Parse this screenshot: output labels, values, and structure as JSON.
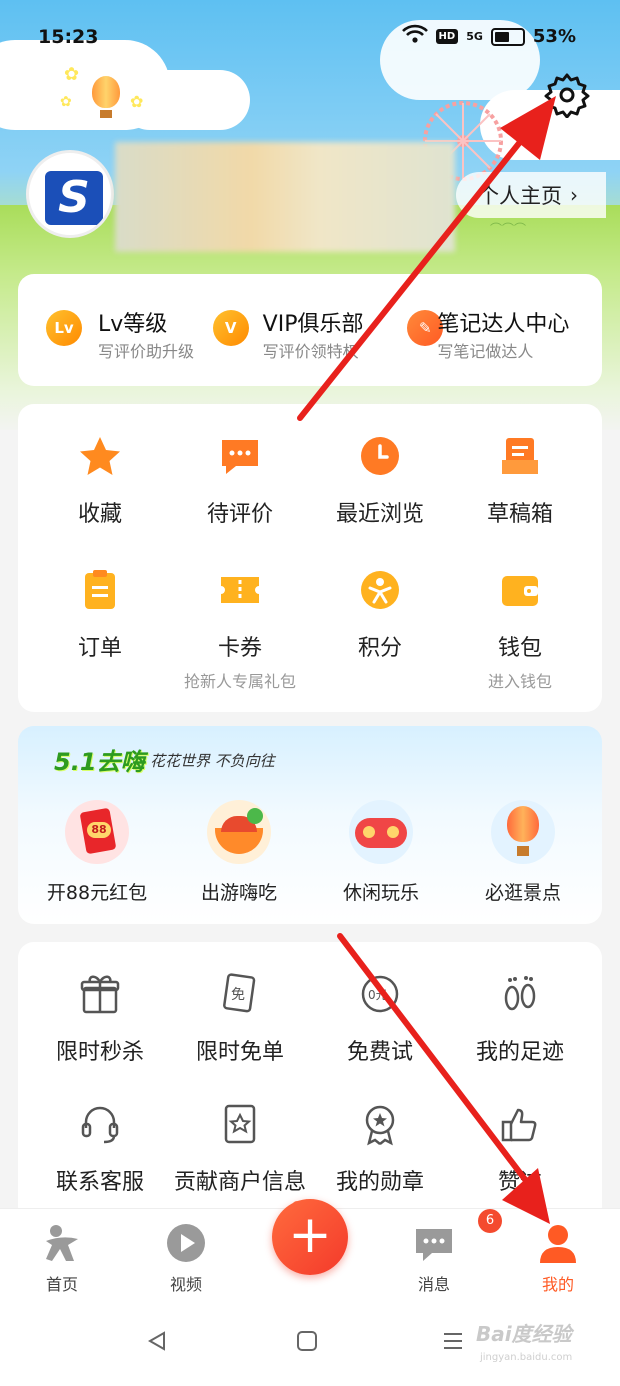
{
  "status": {
    "time": "15:23",
    "battery": "53%",
    "network": "5G",
    "hd": "HD",
    "battery_level": 0.53
  },
  "profile": {
    "link": "个人主页",
    "avatar_letter": "S"
  },
  "levels": [
    {
      "badge": "Lv",
      "title": "Lv等级",
      "sub": "写评价助升级"
    },
    {
      "badge": "V",
      "title": "VIP俱乐部",
      "sub": "写评价领特权"
    },
    {
      "badge": "✎",
      "title": "笔记达人中心",
      "sub": "写笔记做达人"
    }
  ],
  "grid1": [
    {
      "label": "收藏",
      "sub": ""
    },
    {
      "label": "待评价",
      "sub": ""
    },
    {
      "label": "最近浏览",
      "sub": ""
    },
    {
      "label": "草稿箱",
      "sub": ""
    },
    {
      "label": "订单",
      "sub": ""
    },
    {
      "label": "卡券",
      "sub": "抢新人专属礼包"
    },
    {
      "label": "积分",
      "sub": ""
    },
    {
      "label": "钱包",
      "sub": "进入钱包"
    }
  ],
  "promo": {
    "title": "5.1去嗨",
    "subtitle": "花花世界 不负向往",
    "items": [
      {
        "label": "开88元红包"
      },
      {
        "label": "出游嗨吃"
      },
      {
        "label": "休闲玩乐"
      },
      {
        "label": "必逛景点"
      }
    ]
  },
  "grid2": [
    {
      "label": "限时秒杀",
      "glyph": "🎁"
    },
    {
      "label": "限时免单",
      "glyph": "免"
    },
    {
      "label": "免费试",
      "glyph": "0元"
    },
    {
      "label": "我的足迹",
      "glyph": "👣"
    },
    {
      "label": "联系客服",
      "glyph": "🎧"
    },
    {
      "label": "贡献商户信息",
      "glyph": "★"
    },
    {
      "label": "我的勋章",
      "glyph": "✪"
    },
    {
      "label": "赞过",
      "glyph": "👍"
    }
  ],
  "tabs": {
    "home": "首页",
    "video": "视频",
    "add": "+",
    "messages": "消息",
    "messages_badge": "6",
    "mine": "我的"
  },
  "watermark": {
    "main": "Bai度经验",
    "sub": "jingyan.baidu.com"
  },
  "colors": {
    "accent": "#ff6633",
    "orange": "#ff9a1f",
    "active_tab": "#ff5a24",
    "arrow": "#e8211c"
  }
}
